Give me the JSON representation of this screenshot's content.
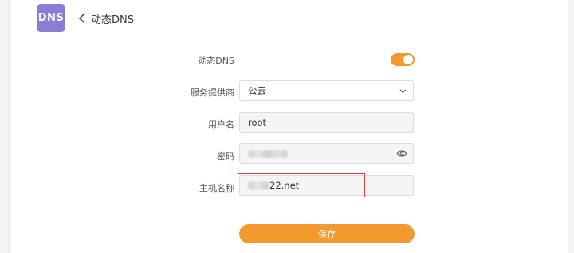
{
  "header": {
    "logo_text": "DNS",
    "back_title": "动态DNS"
  },
  "form": {
    "ddns": {
      "label": "动态DNS",
      "enabled": true
    },
    "provider": {
      "label": "服务提供商",
      "value": "公云"
    },
    "username": {
      "label": "用户名",
      "value": "root"
    },
    "password": {
      "label": "密码"
    },
    "hostname": {
      "label": "主机名称",
      "value": "22.net"
    }
  },
  "save_button": {
    "label": "保存"
  },
  "colors": {
    "accent": "#f39a2e",
    "logo_bg": "#8b7cd6",
    "highlight_border": "#e03a3a"
  },
  "icons": {
    "back": "chevron-left-icon",
    "dropdown": "chevron-down-icon",
    "password_visibility": "eye-icon"
  }
}
